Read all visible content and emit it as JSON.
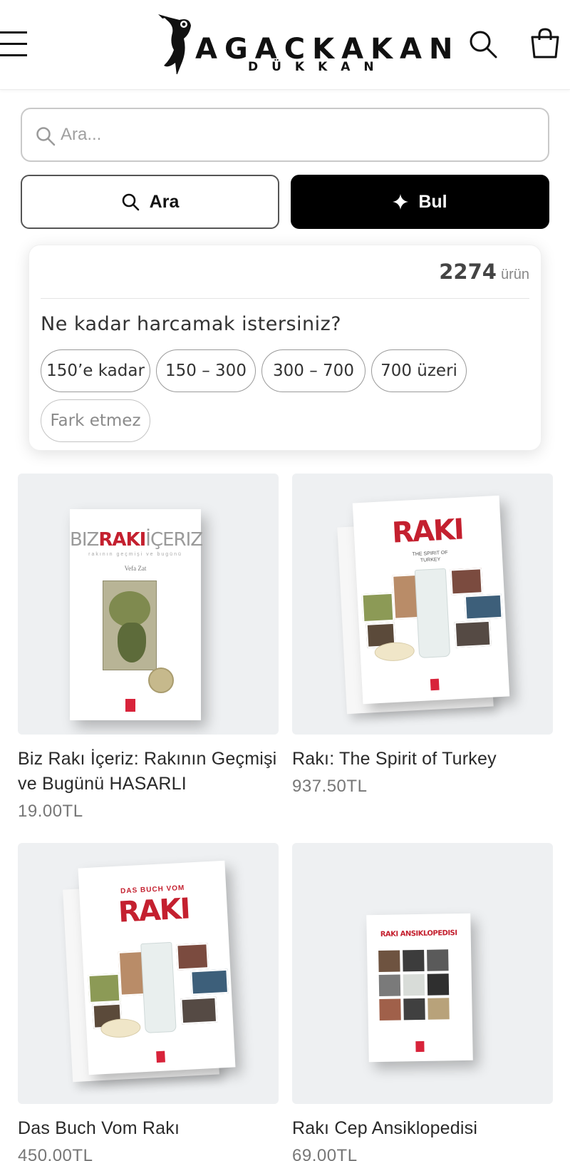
{
  "header": {
    "logo_title": "AGACKAKAN",
    "logo_subtitle": "DÜKKAN",
    "icons": {
      "menu": "hamburger-menu-icon",
      "search": "search-icon",
      "cart": "shopping-bag-icon"
    }
  },
  "search": {
    "placeholder": "Ara...",
    "value": ""
  },
  "actions": {
    "ara_label": "Ara",
    "bul_label": "Bul"
  },
  "filter": {
    "count": "2274",
    "count_unit": "ürün",
    "question": "Ne kadar harcamak istersiniz?",
    "options": [
      "150’e kadar",
      "150 – 300",
      "300 – 700",
      "700 üzeri",
      "Fark etmez"
    ]
  },
  "products": [
    {
      "name": "Biz Rakı İçeriz: Rakının Geçmişi ve Bugünü HASARLI",
      "price": "19.00TL",
      "cover_title_left": "BIZ",
      "cover_title_mid": "RAKI",
      "cover_title_right": "İÇERIZ",
      "cover_subtitle": "rakının geçmişi ve bugünü",
      "cover_author": "Vefa Zat"
    },
    {
      "name": "Rakı: The Spirit of Turkey",
      "price": "937.50TL",
      "cover_title": "RAKI",
      "cover_subtitle": "THE SPIRIT OF TURKEY"
    },
    {
      "name": "Das Buch Vom Rakı",
      "price": "450.00TL",
      "cover_title_small": "DAS BUCH VOM",
      "cover_title": "RAKI"
    },
    {
      "name": "Rakı Cep Ansiklopedisi",
      "price": "69.00TL",
      "cover_title": "RAKI ANSIKLOPEDISI"
    }
  ],
  "colors": {
    "accent": "#000000",
    "cover_red": "#d8233a",
    "image_bg": "#eef0f2"
  }
}
